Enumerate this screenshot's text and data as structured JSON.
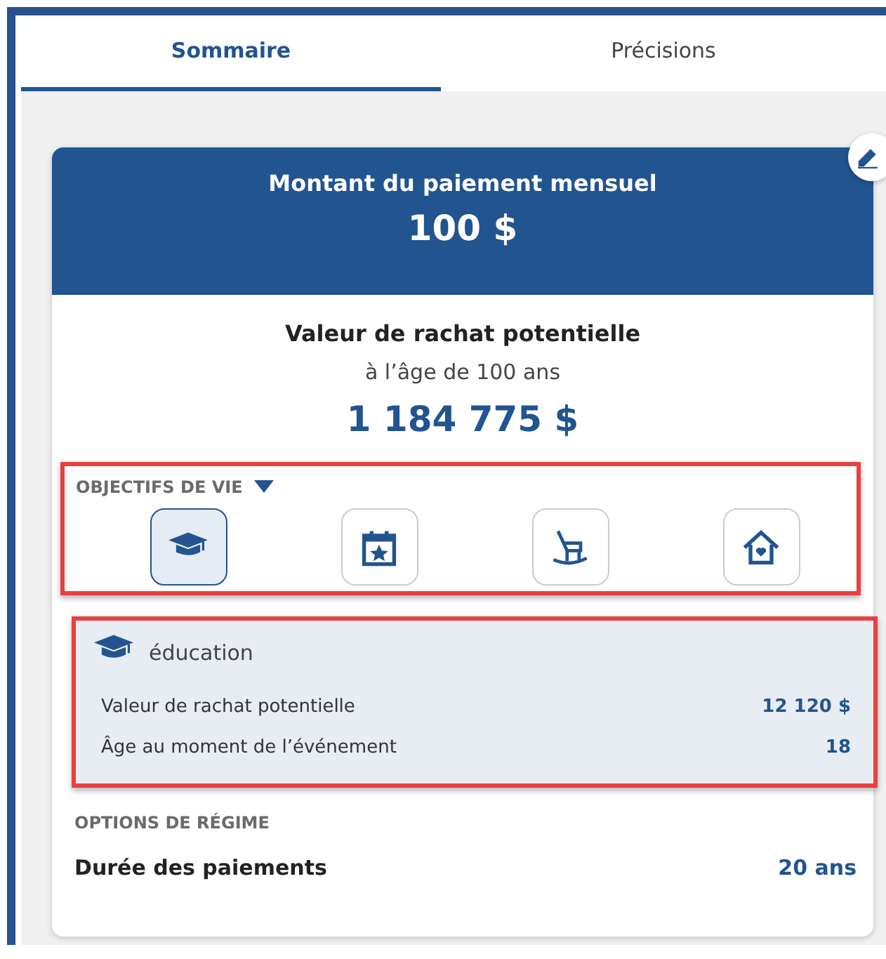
{
  "tabs": [
    {
      "label": "Sommaire",
      "selected": true
    },
    {
      "label": "Précisions",
      "selected": false
    }
  ],
  "payment": {
    "title": "Montant du paiement mensuel",
    "amount": "100 $"
  },
  "surrender": {
    "title": "Valeur de rachat potentielle",
    "subtitle": "à l’âge de 100 ans",
    "amount": "1 184 775 $"
  },
  "life_goals": {
    "label": "OBJECTIFS DE VIE",
    "expanded": true,
    "goals": [
      {
        "kind": "education",
        "selected": true
      },
      {
        "kind": "event",
        "selected": false
      },
      {
        "kind": "retirement",
        "selected": false
      },
      {
        "kind": "home",
        "selected": false
      }
    ]
  },
  "goal_detail": {
    "kind": "education",
    "title": "éducation",
    "rows": [
      {
        "label": "Valeur de rachat potentielle",
        "value": "12 120 $"
      },
      {
        "label": "Âge au moment de l’événement",
        "value": "18"
      }
    ]
  },
  "plan_options": {
    "label": "OPTIONS DE RÉGIME",
    "rows": [
      {
        "label": "Durée des paiements",
        "value": "20 ans"
      }
    ]
  }
}
